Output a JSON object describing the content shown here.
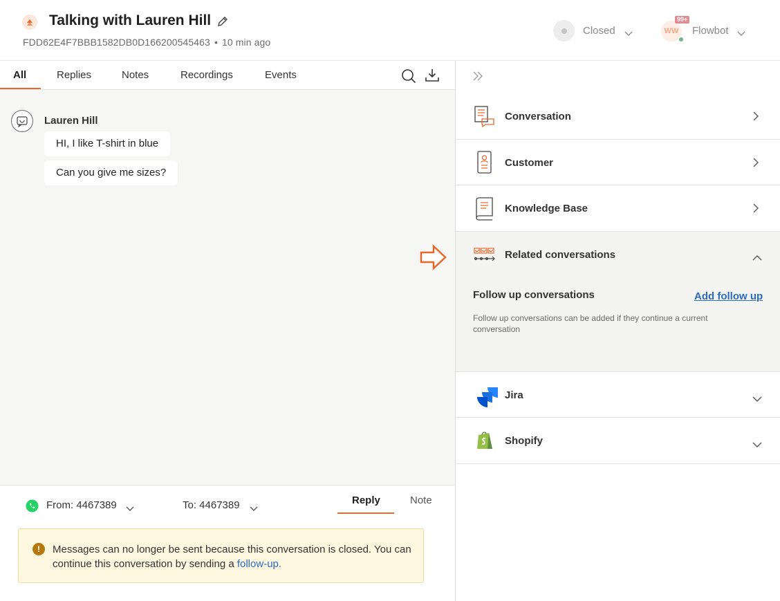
{
  "header": {
    "title": "Talking with Lauren Hill",
    "conversation_id": "FDD62E4F7BBB1582DB0D166200545463",
    "separator": "•",
    "time_ago": "10 min ago",
    "status": "Closed",
    "agent_initials": "WW",
    "notification_badge": "99+",
    "agent_name": "Flowbot"
  },
  "tabs": {
    "items": [
      "All",
      "Replies",
      "Notes",
      "Recordings",
      "Events"
    ],
    "active": "All"
  },
  "messages": {
    "author": "Lauren Hill",
    "bubbles": [
      "HI, I like T-shirt in blue",
      "Can you give me sizes?"
    ]
  },
  "composer": {
    "from_label": "From: 4467389",
    "to_label": "To: 4467389",
    "reply_tab": "Reply",
    "note_tab": "Note",
    "notice_icon": "!",
    "notice_text": "Messages can no longer be sent because this conversation is closed. You can continue this conversation by sending a ",
    "notice_link": "follow-up."
  },
  "sidebar": {
    "sections": [
      {
        "label": "Conversation",
        "icon": "conversation-icon",
        "state": "collapsed"
      },
      {
        "label": "Customer",
        "icon": "customer-icon",
        "state": "collapsed"
      },
      {
        "label": "Knowledge Base",
        "icon": "knowledge-base-icon",
        "state": "collapsed"
      },
      {
        "label": "Related conversations",
        "icon": "related-conversations-icon",
        "state": "expanded"
      },
      {
        "label": "Jira",
        "icon": "jira-icon",
        "state": "collapsed"
      },
      {
        "label": "Shopify",
        "icon": "shopify-icon",
        "state": "collapsed"
      }
    ],
    "related": {
      "title": "Follow up conversations",
      "add_label": "Add follow up",
      "description": "Follow up conversations can be added if they continue a current conversation"
    }
  },
  "colors": {
    "accent": "#e8692b",
    "link": "#2a6bbf",
    "notice_bg": "#fff8e0",
    "whatsapp": "#25d366"
  }
}
